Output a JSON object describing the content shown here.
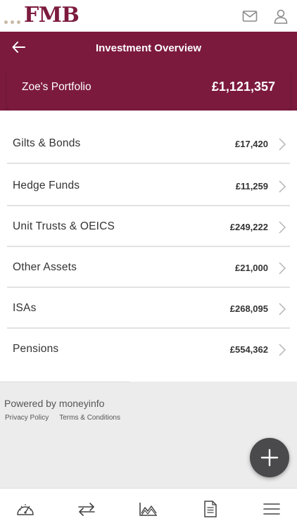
{
  "brand": {
    "name": "FMB",
    "color": "#7c1a3e"
  },
  "header": {
    "title": "Investment Overview",
    "back_icon": "arrow-left-icon"
  },
  "topbar": {
    "icons": [
      "mail-icon",
      "user-icon"
    ]
  },
  "portfolio": {
    "name": "Zoe's Portfolio",
    "total": "£1,121,357"
  },
  "holdings": [
    {
      "label": "Gilts & Bonds",
      "value": "£17,420"
    },
    {
      "label": "Hedge Funds",
      "value": "£11,259"
    },
    {
      "label": "Unit Trusts & OEICS",
      "value": "£249,222"
    },
    {
      "label": "Other Assets",
      "value": "£21,000"
    },
    {
      "label": "ISAs",
      "value": "£268,095"
    },
    {
      "label": "Pensions",
      "value": "£554,362"
    }
  ],
  "footer": {
    "powered_by": "Powered by moneyinfo",
    "privacy": "Privacy Policy",
    "terms": "Terms & Conditions"
  },
  "fab_icon": "plus-icon",
  "bottom_nav": [
    "dashboard-gauge-icon",
    "transfer-icon",
    "chart-icon",
    "document-icon",
    "menu-icon"
  ]
}
